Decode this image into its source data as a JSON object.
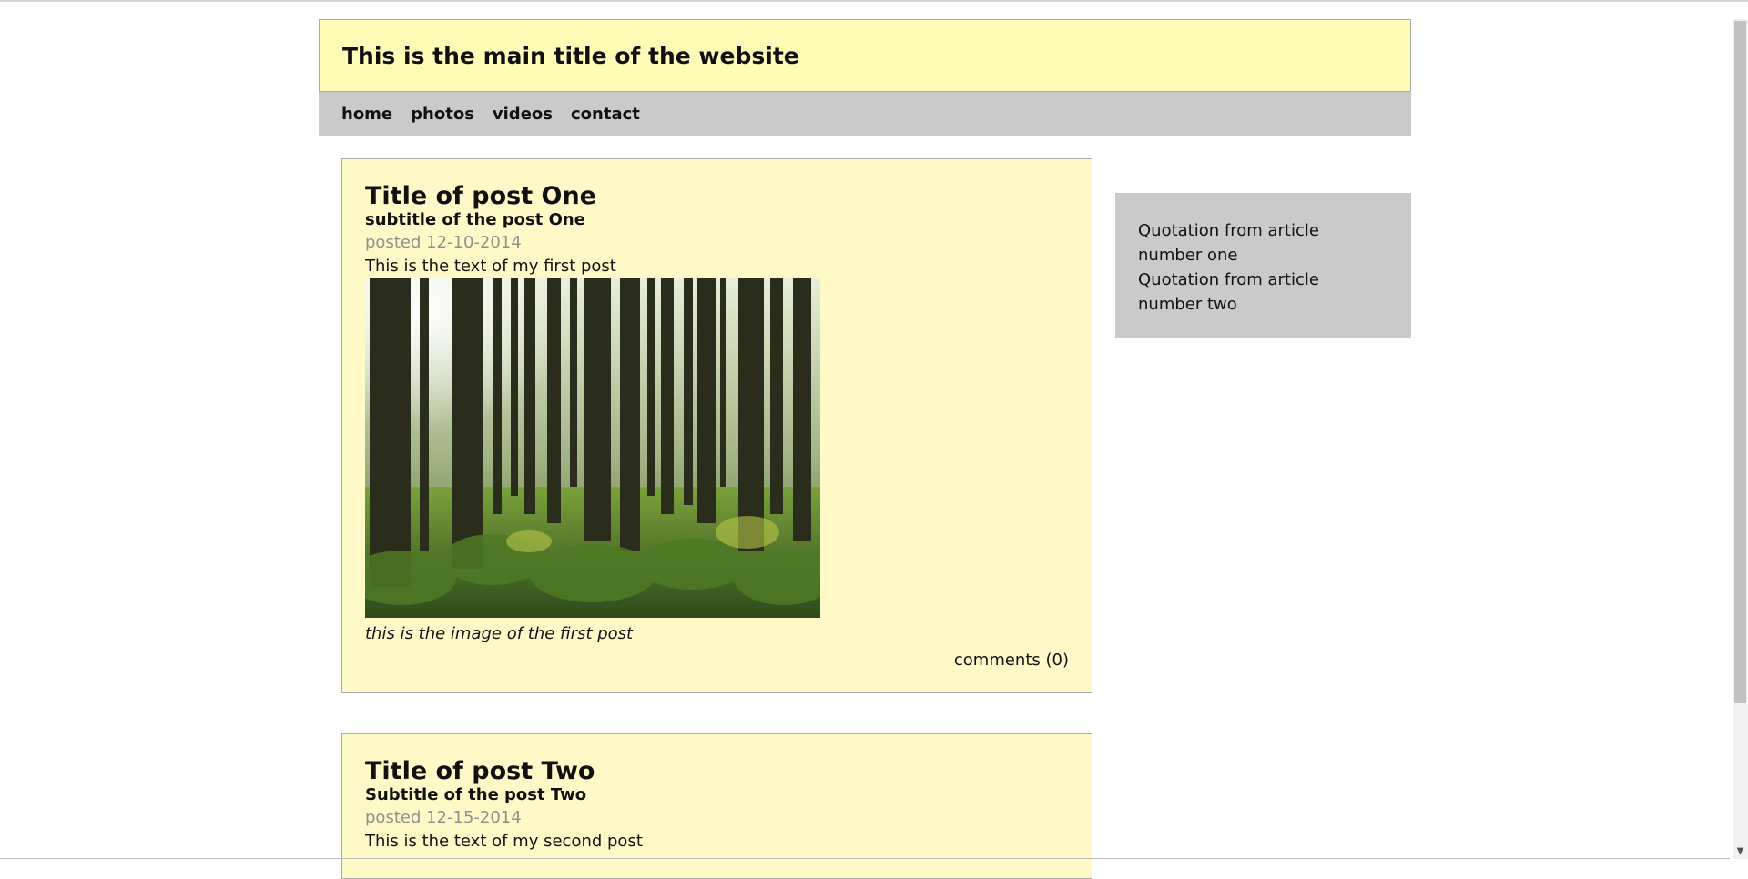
{
  "site": {
    "title": "This is the main title of the website"
  },
  "nav": {
    "items": [
      {
        "label": "home"
      },
      {
        "label": "photos"
      },
      {
        "label": "videos"
      },
      {
        "label": "contact"
      }
    ]
  },
  "posts": [
    {
      "title": "Title of post One",
      "subtitle": "subtitle of the post One",
      "date": "posted 12-10-2014",
      "text": "This is the text of my first post",
      "image_caption": "this is the image of the first post",
      "comments": "comments (0)"
    },
    {
      "title": "Title of post Two",
      "subtitle": "Subtitle of the post Two",
      "date": "posted 12-15-2014",
      "text": "This is the text of my second post"
    }
  ],
  "sidebar": {
    "quotes": [
      "Quotation from article number one",
      "Quotation from article number two"
    ]
  },
  "colors": {
    "header_bg": "#fffcb8",
    "nav_bg": "#cacaca",
    "post_bg": "#fff9c8",
    "date_text": "#8f8f8f"
  },
  "icons": {
    "image": "forest-image"
  }
}
